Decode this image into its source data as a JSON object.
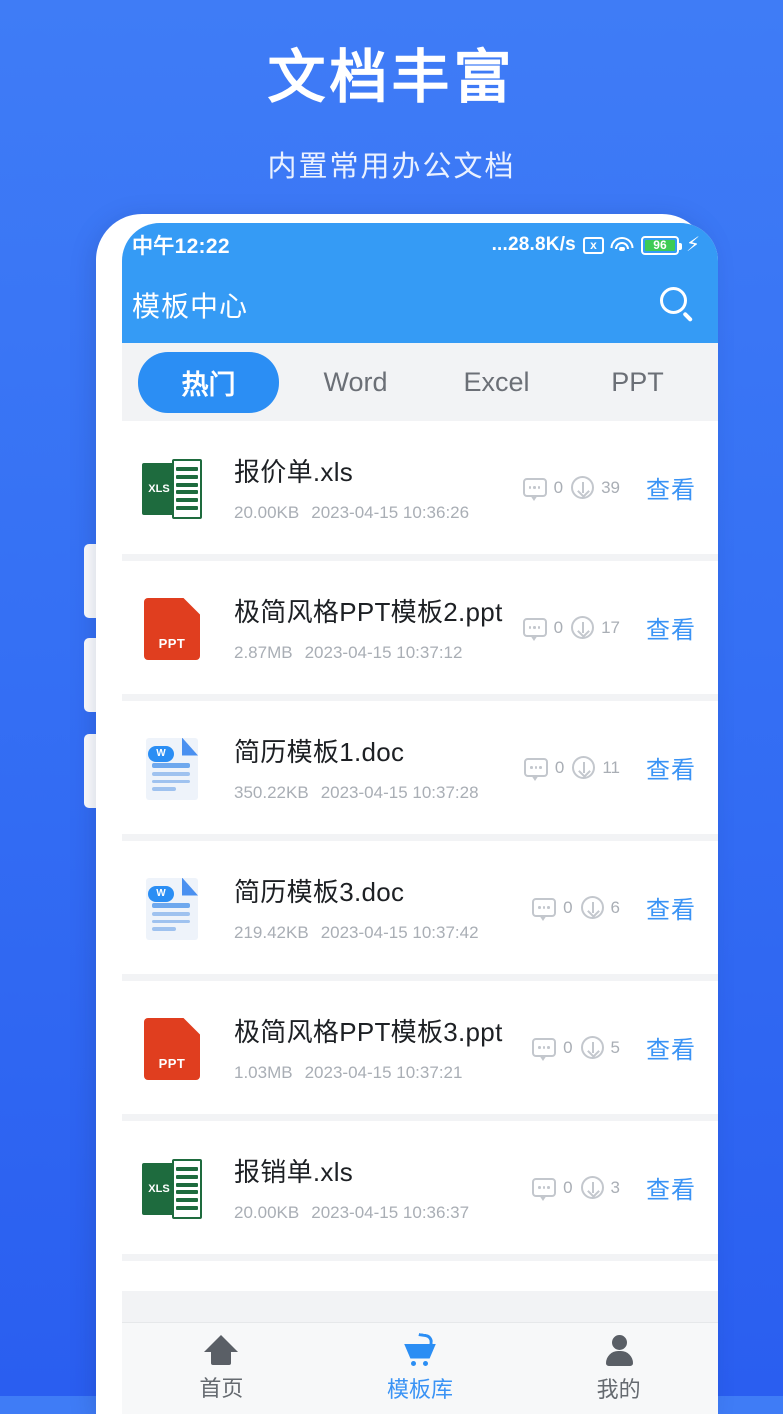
{
  "promo": {
    "title": "文档丰富",
    "subtitle": "内置常用办公文档"
  },
  "statusbar": {
    "time": "中午12:22",
    "net_speed": "...28.8K/s",
    "x_icon_label": "x",
    "battery_level": "96",
    "icons": [
      "x-box-icon",
      "wifi-icon",
      "battery-icon",
      "charging-bolt-icon"
    ]
  },
  "titlebar": {
    "title": "模板中心",
    "search_icon": "search-icon"
  },
  "tabs": [
    {
      "label": "热门",
      "active": true
    },
    {
      "label": "Word",
      "active": false
    },
    {
      "label": "Excel",
      "active": false
    },
    {
      "label": "PPT",
      "active": false
    }
  ],
  "list": {
    "view_label": "查看",
    "items": [
      {
        "name": "报价单.xls",
        "size": "20.00KB",
        "date": "2023-04-15 10:36:26",
        "comments": "0",
        "downloads": "39",
        "icon": "xls-file-icon",
        "type": "xls"
      },
      {
        "name": "极简风格PPT模板2.ppt",
        "size": "2.87MB",
        "date": "2023-04-15 10:37:12",
        "comments": "0",
        "downloads": "17",
        "icon": "ppt-file-icon",
        "type": "ppt"
      },
      {
        "name": "简历模板1.doc",
        "size": "350.22KB",
        "date": "2023-04-15 10:37:28",
        "comments": "0",
        "downloads": "11",
        "icon": "doc-file-icon",
        "type": "doc"
      },
      {
        "name": "简历模板3.doc",
        "size": "219.42KB",
        "date": "2023-04-15 10:37:42",
        "comments": "0",
        "downloads": "6",
        "icon": "doc-file-icon",
        "type": "doc"
      },
      {
        "name": "极简风格PPT模板3.ppt",
        "size": "1.03MB",
        "date": "2023-04-15 10:37:21",
        "comments": "0",
        "downloads": "5",
        "icon": "ppt-file-icon",
        "type": "ppt"
      },
      {
        "name": "报销单.xls",
        "size": "20.00KB",
        "date": "2023-04-15 10:36:37",
        "comments": "0",
        "downloads": "3",
        "icon": "xls-file-icon",
        "type": "xls"
      }
    ]
  },
  "bottomnav": [
    {
      "label": "首页",
      "icon": "home-icon",
      "active": false
    },
    {
      "label": "模板库",
      "icon": "cart-icon",
      "active": true
    },
    {
      "label": "我的",
      "icon": "person-icon",
      "active": false
    }
  ],
  "colors": {
    "background_top": "#3f7cf6",
    "background_bottom": "#2a5ef0",
    "header_blue": "#359bf5",
    "accent_blue": "#2b8ef4",
    "link_blue": "#3a93f5",
    "xls_green": "#1e6b3e",
    "ppt_red": "#e03e1f",
    "battery_green": "#3ecb55"
  }
}
